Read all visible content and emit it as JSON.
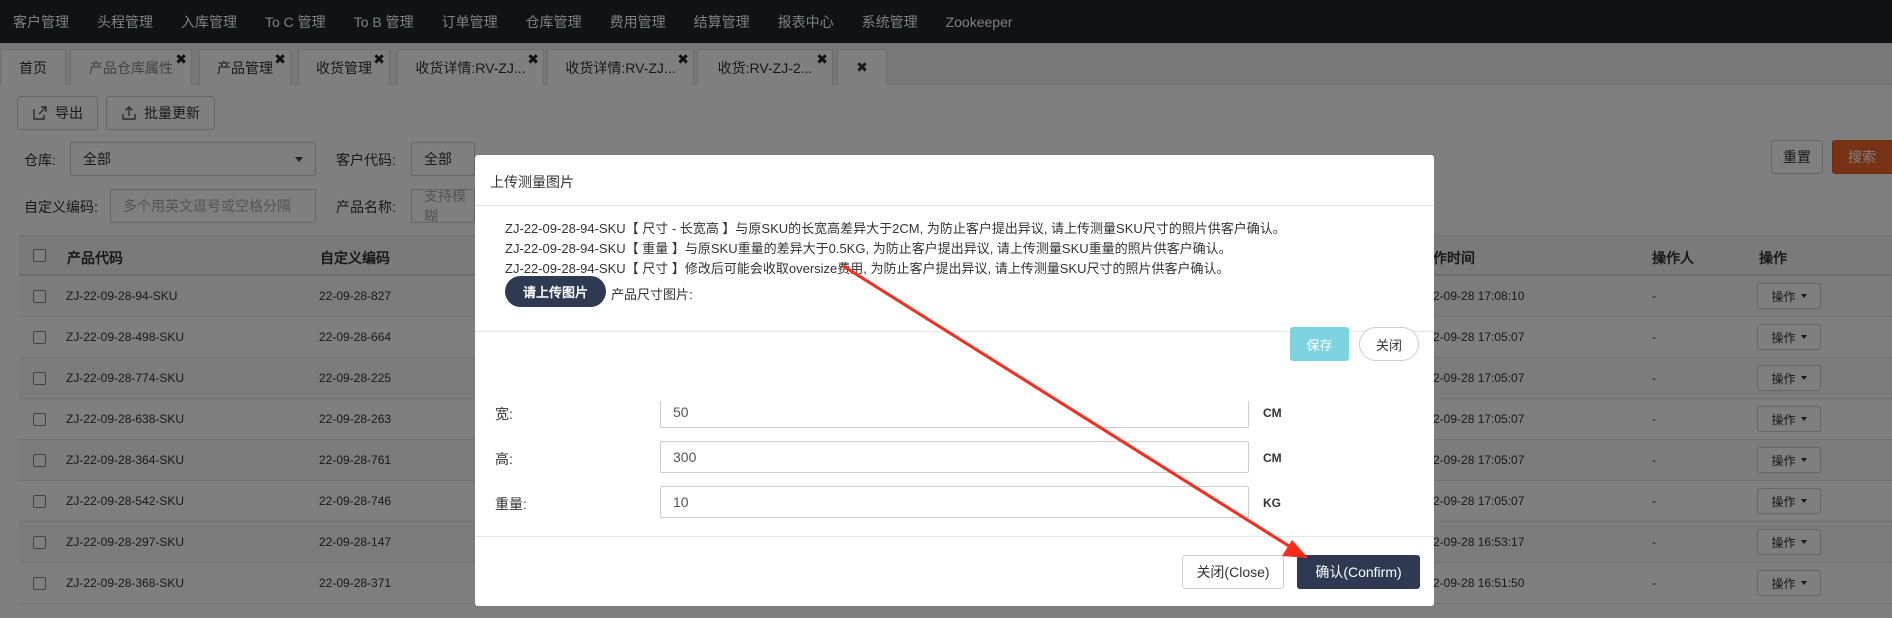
{
  "nav": [
    "客户管理",
    "头程管理",
    "入库管理",
    "To C 管理",
    "To B 管理",
    "订单管理",
    "仓库管理",
    "费用管理",
    "结算管理",
    "报表中心",
    "系统管理",
    "Zookeeper"
  ],
  "tabs": [
    {
      "label": "首页",
      "close": false
    },
    {
      "label": "产品仓库属性",
      "close": true
    },
    {
      "label": "产品管理",
      "close": true
    },
    {
      "label": "收货管理",
      "close": true
    },
    {
      "label": "收货详情:RV-ZJ...",
      "close": true
    },
    {
      "label": "收货详情:RV-ZJ...",
      "close": true
    },
    {
      "label": "收货:RV-ZJ-2...",
      "close": true
    }
  ],
  "close_all_glyph": "✖",
  "close_glyph": "✖",
  "toolbar": {
    "export": "导出",
    "batch_update": "批量更新"
  },
  "filters": {
    "warehouse_label": "仓库:",
    "warehouse_value": "全部",
    "customer_label": "客户代码:",
    "customer_value": "全部",
    "custom_code_label": "自定义编码:",
    "custom_code_placeholder": "多个用英文逗号或空格分隔",
    "product_name_label": "产品名称:",
    "product_name_placeholder": "支持模糊",
    "reset": "重置",
    "search": "搜索"
  },
  "table": {
    "headers": {
      "product_code": "产品代码",
      "custom_code": "自定义编码",
      "time": "作时间",
      "operator": "操作人",
      "action": "操作"
    },
    "rows": [
      {
        "code": "ZJ-22-09-28-94-SKU",
        "custom": "22-09-28-827",
        "time": "2-09-28 17:08:10",
        "op": "-",
        "action": "操作"
      },
      {
        "code": "ZJ-22-09-28-498-SKU",
        "custom": "22-09-28-664",
        "time": "2-09-28 17:05:07",
        "op": "-",
        "action": "操作"
      },
      {
        "code": "ZJ-22-09-28-774-SKU",
        "custom": "22-09-28-225",
        "time": "2-09-28 17:05:07",
        "op": "-",
        "action": "操作"
      },
      {
        "code": "ZJ-22-09-28-638-SKU",
        "custom": "22-09-28-263",
        "time": "2-09-28 17:05:07",
        "op": "-",
        "action": "操作"
      },
      {
        "code": "ZJ-22-09-28-364-SKU",
        "custom": "22-09-28-761",
        "time": "2-09-28 17:05:07",
        "op": "-",
        "action": "操作"
      },
      {
        "code": "ZJ-22-09-28-542-SKU",
        "custom": "22-09-28-746",
        "time": "2-09-28 17:05:07",
        "op": "-",
        "action": "操作"
      },
      {
        "code": "ZJ-22-09-28-297-SKU",
        "custom": "22-09-28-147",
        "time": "2-09-28 16:53:17",
        "op": "-",
        "action": "操作"
      },
      {
        "code": "ZJ-22-09-28-368-SKU",
        "custom": "22-09-28-371",
        "time": "2-09-28 16:51:50",
        "op": "-",
        "action": "操作"
      }
    ]
  },
  "dimension_modal": {
    "width_label": "宽:",
    "width_value": "50",
    "width_unit": "CM",
    "height_label": "高:",
    "height_value": "300",
    "height_unit": "CM",
    "weight_label": "重量:",
    "weight_value": "10",
    "weight_unit": "KG",
    "close": "关闭(Close)",
    "confirm": "确认(Confirm)"
  },
  "upload_modal": {
    "title": "上传测量图片",
    "messages": [
      "ZJ-22-09-28-94-SKU【 尺寸 - 长宽高 】与原SKU的长宽高差异大于2CM, 为防止客户提出异议, 请上传测量SKU尺寸的照片供客户确认。",
      "ZJ-22-09-28-94-SKU【 重量 】与原SKU重量的差异大于0.5KG, 为防止客户提出异议, 请上传测量SKU重量的照片供客户确认。",
      "ZJ-22-09-28-94-SKU【 尺寸 】修改后可能会收取oversize费用, 为防止客户提出异议, 请上传测量SKU尺寸的照片供客户确认。"
    ],
    "upload_button": "请上传图片",
    "upload_label": "产品尺寸图片:",
    "save": "保存",
    "close": "关闭"
  },
  "colors": {
    "nav_bg": "#212529",
    "accent": "#f0652d",
    "primary": "#2e3a52",
    "save": "#7ed3e0",
    "arrow": "#ff2a1a"
  }
}
